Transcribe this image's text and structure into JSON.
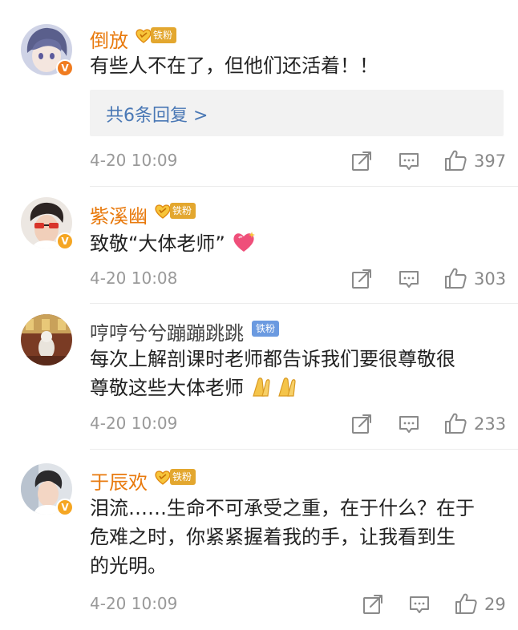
{
  "comments": [
    {
      "username": "倒放",
      "fan_badge": "铁粉",
      "text": "有些人不在了，但他们还活着！！",
      "replies": "共6条回复 >",
      "time": "4-20 10:09",
      "likes": "397"
    },
    {
      "username": "紫溪幽",
      "fan_badge": "铁粉",
      "text": "致敬“大体老师”",
      "time": "4-20 10:08",
      "likes": "303"
    },
    {
      "username": "哼哼兮兮蹦蹦跳跳",
      "fan_badge": "铁粉",
      "text_line1": "每次上解剖课时老师都告诉我们要很尊敬很",
      "text_line2": "尊敬这些大体老师",
      "time": "4-20 10:09",
      "likes": "233"
    },
    {
      "username": "于辰欢",
      "fan_badge": "铁粉",
      "text_line1": "泪流……生命不可承受之重，在于什么？在于",
      "text_line2": "危难之时，你紧紧握着我的手，让我看到生",
      "text_line3": "的光明。",
      "time": "4-20 10:09",
      "likes": "29"
    }
  ],
  "icons": {
    "share": "share-icon",
    "comment": "comment-icon",
    "like": "thumbs-up-icon",
    "verified": "verified-v-icon"
  },
  "colors": {
    "username": "#e8790c",
    "link": "#4a78b5",
    "meta": "#999999",
    "fan_gold": "#e3a72f",
    "fan_blue": "#6b9ae0"
  }
}
